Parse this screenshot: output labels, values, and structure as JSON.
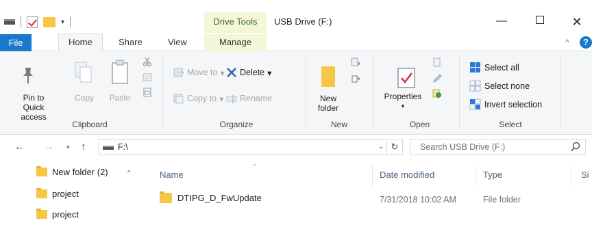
{
  "title_bar": {
    "context_tab_label": "Drive Tools",
    "window_title": "USB Drive (F:)",
    "minimize_glyph": "—",
    "close_glyph": "✕",
    "qat_dropdown_glyph": "▾"
  },
  "tabs": {
    "file": "File",
    "home": "Home",
    "share": "Share",
    "view": "View",
    "manage": "Manage",
    "collapse_glyph": "^",
    "help_glyph": "?"
  },
  "ribbon": {
    "clipboard": {
      "group_label": "Clipboard",
      "pin_label": "Pin to Quick access",
      "copy_label": "Copy",
      "paste_label": "Paste"
    },
    "organize": {
      "group_label": "Organize",
      "move_to": "Move to",
      "copy_to": "Copy to",
      "delete": "Delete",
      "rename": "Rename",
      "dropdown_glyph": "▾"
    },
    "new": {
      "group_label": "New",
      "new_folder": "New folder"
    },
    "open": {
      "group_label": "Open",
      "properties": "Properties",
      "dropdown_glyph": "▾"
    },
    "select": {
      "group_label": "Select",
      "select_all": "Select all",
      "select_none": "Select none",
      "invert_selection": "Invert selection"
    }
  },
  "address_bar": {
    "back_glyph": "←",
    "forward_glyph": "→",
    "recent_glyph": "▾",
    "up_glyph": "↑",
    "path": "F:\\",
    "dropdown_glyph": "⌄",
    "refresh_glyph": "↻",
    "search_placeholder": "Search USB Drive (F:)"
  },
  "nav_pane": {
    "scroll_caret": "^",
    "items": [
      {
        "label": "New folder (2)"
      },
      {
        "label": "project"
      },
      {
        "label": "project"
      }
    ]
  },
  "file_list": {
    "sort_caret": "⌄",
    "columns": {
      "name": "Name",
      "date_modified": "Date modified",
      "type": "Type",
      "size": "Si"
    },
    "rows": [
      {
        "name": "DTIPG_D_FwUpdate",
        "date_modified": "7/31/2018 10:02 AM",
        "type": "File folder"
      }
    ]
  },
  "colors": {
    "file_tab": "#1979ca",
    "drive_tools_band": "#f3f7d8",
    "drive_tools_text": "#3a6f1c",
    "ribbon_bg": "#f5f6f7",
    "folder_yellow": "#f6c744"
  }
}
